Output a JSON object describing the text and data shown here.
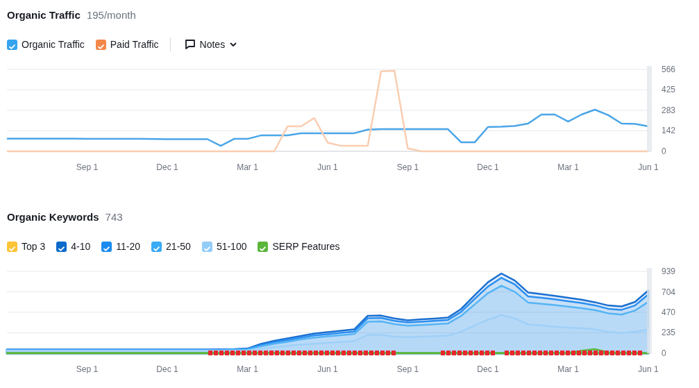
{
  "sections": [
    {
      "title": "Organic Traffic",
      "value": "195/month",
      "legend": [
        {
          "checked": true,
          "color": "#36a3ee"
        },
        {
          "checked": true,
          "color": "#f4884a"
        }
      ],
      "notes_button": {
        "label": "Notes"
      },
      "chart_data": {
        "type": "line",
        "grid": true,
        "ylim": [
          0,
          566
        ],
        "yticks": [
          0,
          142,
          283,
          425,
          566
        ],
        "categories": [
          null,
          null,
          null,
          null,
          null,
          null,
          "Sep 1",
          null,
          null,
          null,
          null,
          null,
          "Dec 1",
          null,
          null,
          null,
          null,
          null,
          "Mar 1",
          null,
          null,
          null,
          null,
          null,
          "Jun 1",
          null,
          null,
          null,
          null,
          null,
          "Sep 1",
          null,
          null,
          null,
          null,
          null,
          "Dec 1",
          null,
          null,
          null,
          null,
          null,
          "Mar 1",
          null,
          null,
          null,
          null,
          null,
          "Jun 1"
        ],
        "series": [
          {
            "name": "Organic Traffic",
            "color": "#4aa5e8",
            "values": [
              88,
              88,
              88,
              88,
              88,
              88,
              87,
              87,
              87,
              86,
              86,
              85,
              84,
              84,
              84,
              84,
              38,
              86,
              86,
              110,
              110,
              110,
              125,
              125,
              125,
              125,
              125,
              150,
              153,
              153,
              153,
              153,
              153,
              153,
              62,
              62,
              168,
              170,
              175,
              192,
              254,
              254,
              206,
              254,
              288,
              250,
              192,
              190,
              173
            ]
          },
          {
            "name": "Paid Traffic",
            "color": "#f9cdb1",
            "values": [
              0,
              0,
              0,
              0,
              0,
              0,
              0,
              0,
              0,
              0,
              0,
              0,
              0,
              0,
              0,
              0,
              0,
              0,
              0,
              0,
              0,
              172,
              172,
              230,
              60,
              38,
              38,
              38,
              553,
              556,
              20,
              0,
              0,
              0,
              0,
              0,
              0,
              0,
              0,
              0,
              0,
              0,
              0,
              0,
              0,
              0,
              0,
              0,
              0
            ]
          }
        ]
      }
    },
    {
      "title": "Organic Keywords",
      "value": "743",
      "legend": [
        {
          "checked": true,
          "color": "#fcc434"
        },
        {
          "checked": true,
          "color": "#0d6bcb"
        },
        {
          "checked": true,
          "color": "#1a8cf0"
        },
        {
          "checked": true,
          "color": "#3aabf5"
        },
        {
          "checked": true,
          "color": "#93cdf8"
        },
        {
          "checked": true,
          "color": "#5bb73b"
        }
      ],
      "chart_data": {
        "type": "area",
        "grid": true,
        "ylim": [
          0,
          939
        ],
        "yticks": [
          0,
          235,
          470,
          704,
          939
        ],
        "categories": [
          null,
          null,
          null,
          null,
          null,
          null,
          "Sep 1",
          null,
          null,
          null,
          null,
          null,
          "Dec 1",
          null,
          null,
          null,
          null,
          null,
          "Mar 1",
          null,
          null,
          null,
          null,
          null,
          "Jun 1",
          null,
          null,
          null,
          null,
          null,
          "Sep 1",
          null,
          null,
          null,
          null,
          null,
          "Dec 1",
          null,
          null,
          null,
          null,
          null,
          "Mar 1",
          null,
          null,
          null,
          null,
          null,
          "Jun 1"
        ],
        "series": [
          {
            "name": "Top 3",
            "color": "#fcc434",
            "values": [
              5,
              5,
              5,
              5,
              5,
              5,
              5,
              5,
              5,
              5,
              5,
              5,
              5,
              5,
              5,
              5,
              5,
              5,
              5,
              5,
              5,
              5,
              5,
              5,
              5,
              5,
              5,
              5,
              5,
              5,
              5,
              5,
              5,
              5,
              5,
              5,
              5,
              5,
              5,
              5,
              5,
              5,
              5,
              5,
              5,
              5,
              5,
              5,
              5
            ]
          },
          {
            "name": "4-10",
            "color": "#1a6fd0",
            "values": [
              43,
              43,
              43,
              43,
              43,
              43,
              43,
              43,
              43,
              43,
              43,
              43,
              43,
              43,
              43,
              43,
              45,
              48,
              55,
              108,
              143,
              170,
              199,
              227,
              243,
              259,
              275,
              430,
              433,
              400,
              379,
              389,
              399,
              409,
              509,
              665,
              815,
              915,
              835,
              697,
              678,
              659,
              637,
              615,
              586,
              548,
              537,
              589,
              720
            ]
          },
          {
            "name": "11-20",
            "color": "#2a8ff0",
            "values": [
              40,
              40,
              40,
              40,
              40,
              40,
              40,
              40,
              40,
              40,
              40,
              40,
              40,
              40,
              40,
              40,
              42,
              45,
              50,
              95,
              127,
              152,
              180,
              205,
              220,
              235,
              250,
              402,
              406,
              372,
              353,
              362,
              372,
              382,
              477,
              624,
              765,
              865,
              790,
              652,
              636,
              619,
              598,
              577,
              550,
              510,
              498,
              548,
              675
            ]
          },
          {
            "name": "21-50",
            "color": "#55b4f5",
            "values": [
              36,
              36,
              36,
              36,
              36,
              36,
              36,
              36,
              36,
              36,
              36,
              36,
              36,
              36,
              36,
              36,
              37,
              39,
              43,
              80,
              110,
              132,
              158,
              180,
              194,
              208,
              222,
              362,
              366,
              335,
              317,
              325,
              333,
              341,
              430,
              560,
              690,
              775,
              705,
              582,
              567,
              552,
              535,
              518,
              495,
              458,
              444,
              490,
              590
            ]
          },
          {
            "name": "51-100",
            "color": "#9fd0f8",
            "values": [
              30,
              30,
              30,
              30,
              30,
              30,
              30,
              30,
              30,
              30,
              30,
              30,
              30,
              30,
              30,
              30,
              30,
              30,
              33,
              52,
              70,
              85,
              100,
              110,
              120,
              130,
              140,
              210,
              212,
              190,
              185,
              190,
              196,
              202,
              250,
              320,
              385,
              440,
              400,
              332,
              320,
              305,
              295,
              288,
              275,
              245,
              233,
              248,
              268
            ]
          },
          {
            "name": "SERP Features",
            "color": "#5bb73b",
            "values": [
              3,
              3,
              3,
              3,
              3,
              3,
              3,
              3,
              3,
              3,
              3,
              3,
              3,
              3,
              3,
              3,
              3,
              3,
              3,
              3,
              3,
              3,
              3,
              3,
              3,
              3,
              3,
              3,
              3,
              3,
              3,
              3,
              3,
              3,
              3,
              3,
              3,
              3,
              3,
              3,
              3,
              4,
              5,
              30,
              48,
              10,
              5,
              5,
              5
            ]
          }
        ]
      }
    }
  ]
}
